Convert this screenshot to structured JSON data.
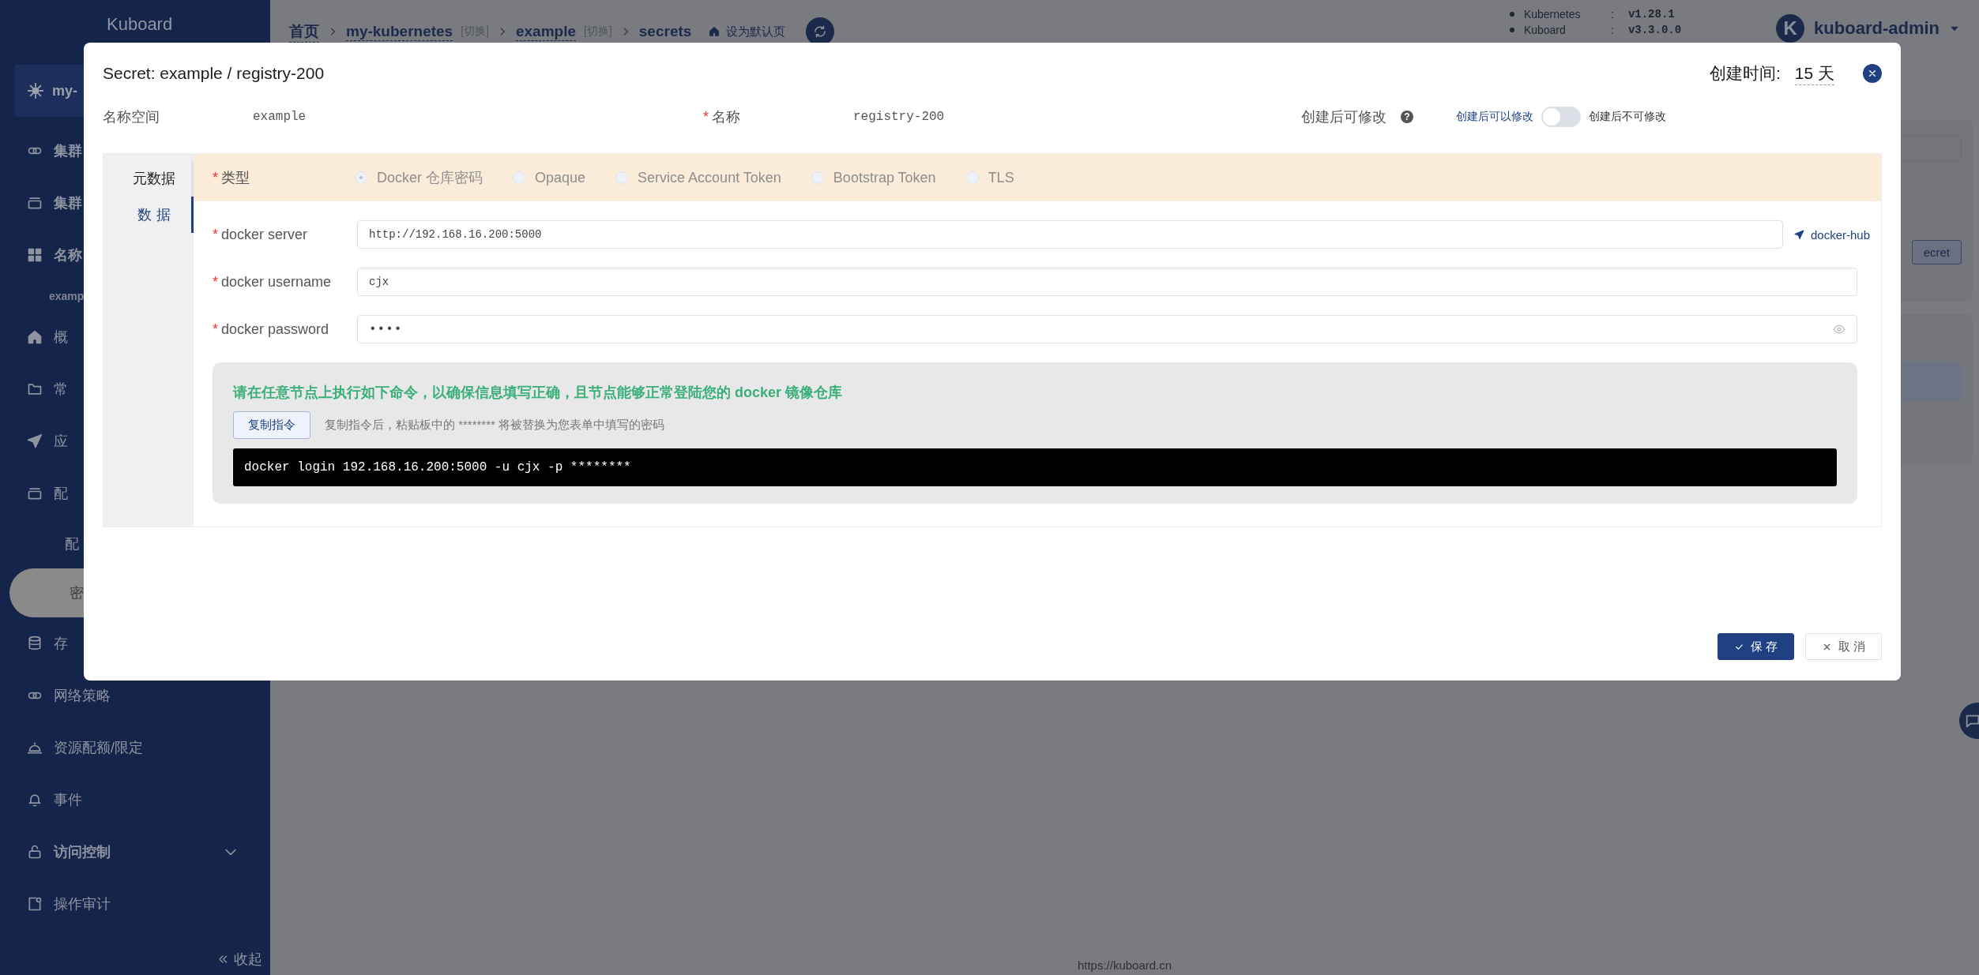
{
  "sidebar": {
    "title": "Kuboard",
    "cluster": "my-",
    "items": [
      {
        "kind": "group",
        "label": "集群",
        "selected": false
      },
      {
        "kind": "group",
        "label": "集群",
        "selected": false
      },
      {
        "kind": "group",
        "label": "名称",
        "selected": false
      },
      {
        "kind": "namespace",
        "label": "examp",
        "selected": false
      },
      {
        "kind": "item",
        "label": "概",
        "selected": false
      },
      {
        "kind": "item",
        "label": "常",
        "selected": false
      },
      {
        "kind": "item",
        "label": "应",
        "selected": false
      },
      {
        "kind": "item",
        "label": "配",
        "selected": false
      },
      {
        "kind": "sub",
        "label": "配",
        "selected": false
      },
      {
        "kind": "sub",
        "label": "密",
        "selected": true
      },
      {
        "kind": "item",
        "label": "存",
        "selected": false
      },
      {
        "kind": "item",
        "label": "网络策略",
        "selected": false
      },
      {
        "kind": "item",
        "label": "资源配额/限定",
        "selected": false
      },
      {
        "kind": "item",
        "label": "事件",
        "selected": false
      },
      {
        "kind": "menu",
        "label": "访问控制",
        "selected": false
      },
      {
        "kind": "item",
        "label": "操作审计",
        "selected": false
      }
    ],
    "collapse": "收起"
  },
  "header": {
    "breadcrumbs": [
      {
        "label": "首页"
      },
      {
        "label": "my-kubernetes",
        "switch": "[切换]"
      },
      {
        "label": "example",
        "switch": "[切换]"
      },
      {
        "label": "secrets"
      }
    ],
    "set_default": "设为默认页",
    "versions": [
      {
        "name": "Kubernetes",
        "sep": ":",
        "value": "v1.28.1"
      },
      {
        "name": "Kuboard",
        "sep": ":",
        "value": "v3.3.0.0"
      }
    ],
    "user": {
      "initial": "K",
      "name": "kuboard-admin"
    }
  },
  "background": {
    "button": "ecret"
  },
  "footer": "https://kuboard.cn",
  "modal": {
    "title": "Secret: example / registry-200",
    "created_label": "创建时间:",
    "created_value": "15 天",
    "namespace_label": "名称空间",
    "namespace": "example",
    "name_mark": "*",
    "name_label": "名称",
    "name": "registry-200",
    "editable_label": "创建后可修改",
    "help": "?",
    "editable_left": "创建后可以修改",
    "editable_right": "创建后不可修改",
    "toggle_on": false,
    "tabs": [
      {
        "label": "元数据",
        "selected": false
      },
      {
        "label": "数据",
        "selected": true
      }
    ],
    "type": {
      "mark": "*",
      "label": "类型",
      "options": [
        {
          "label": "Docker 仓库密码",
          "selected": true
        },
        {
          "label": "Opaque",
          "selected": false
        },
        {
          "label": "Service Account Token",
          "selected": false
        },
        {
          "label": "Bootstrap Token",
          "selected": false
        },
        {
          "label": "TLS",
          "selected": false
        }
      ]
    },
    "fields": [
      {
        "kind": "link",
        "mark": "*",
        "label": "docker server",
        "value": "http://192.168.16.200:5000",
        "link": "docker-hub"
      },
      {
        "kind": "text",
        "mark": "*",
        "label": "docker username",
        "value": "cjx"
      },
      {
        "kind": "password",
        "mark": "*",
        "label": "docker password",
        "value": "••••"
      }
    ],
    "hint": {
      "title": "请在任意节点上执行如下命令，以确保信息填写正确，且节点能够正常登陆您的 docker 镜像仓库",
      "copy_button": "复制指令",
      "note": "复制指令后，粘贴板中的 ******** 将被替换为您表单中填写的密码",
      "command": "docker login 192.168.16.200:5000 -u cjx -p ********"
    },
    "buttons": [
      {
        "kind": "primary",
        "label": "保 存"
      },
      {
        "kind": "default",
        "label": "取 消"
      }
    ]
  }
}
